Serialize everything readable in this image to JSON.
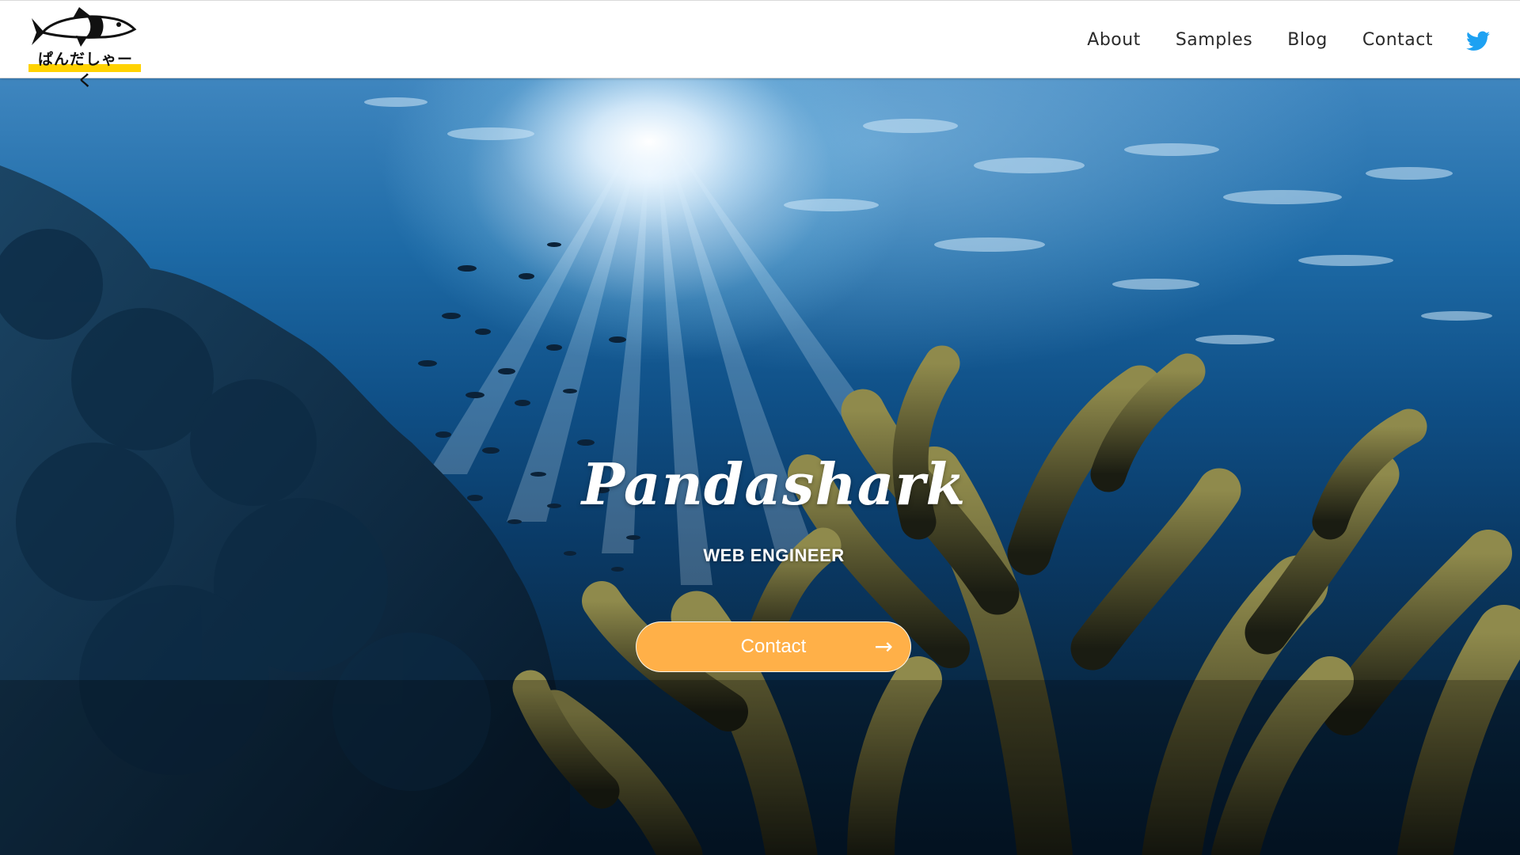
{
  "brand": {
    "logo_text": "ぱんだしゃーく",
    "logo_icon": "shark-icon",
    "accent": "#ffd200"
  },
  "nav": {
    "items": [
      {
        "label": "About"
      },
      {
        "label": "Samples"
      },
      {
        "label": "Blog"
      },
      {
        "label": "Contact"
      }
    ],
    "twitter_icon": "twitter-icon",
    "twitter_color": "#1da1f2"
  },
  "hero": {
    "title": "Pandashark",
    "subtitle": "WEB ENGINEER",
    "cta_label": "Contact",
    "cta_icon": "arrow-right-icon",
    "cta_color": "#ffb048",
    "background": "underwater-coral-reef-photo"
  }
}
